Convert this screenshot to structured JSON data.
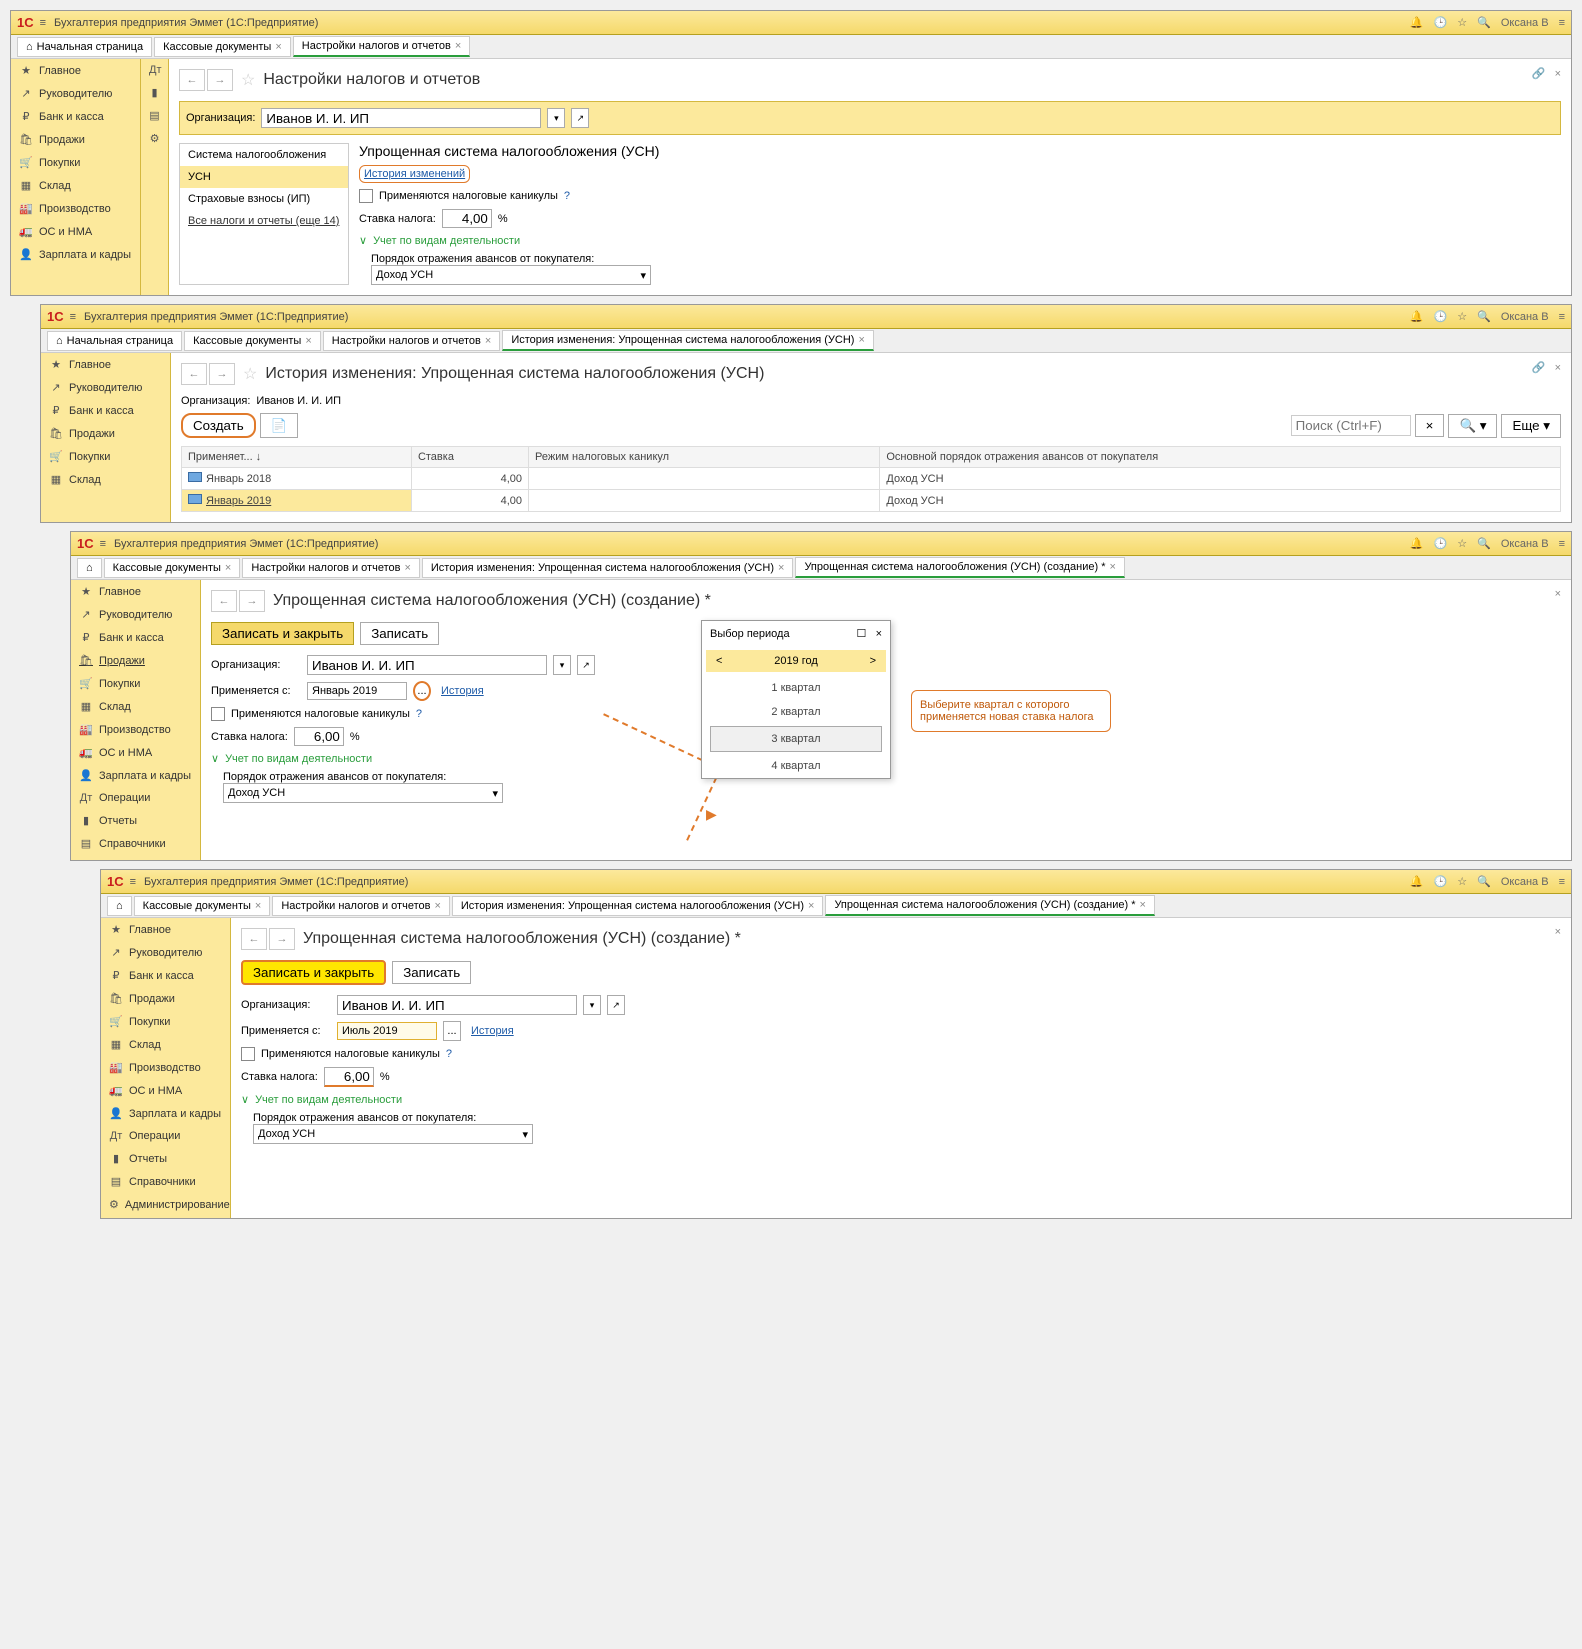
{
  "common": {
    "app_title": "Бухгалтерия предприятия Эммет  (1С:Предприятие)",
    "user": "Оксана В",
    "home": "Начальная страница",
    "tabs": {
      "kass": "Кассовые документы",
      "settings": "Настройки налогов и отчетов",
      "history": "История изменения: Упрощенная система налогообложения (УСН)",
      "create": "Упрощенная система налогообложения (УСН) (создание) *"
    },
    "org_label": "Организация:",
    "org_value": "Иванов И. И. ИП",
    "save_close": "Записать и закрыть",
    "save": "Записать",
    "applies_from": "Применяется с:",
    "history_link": "История",
    "history_changes": "История изменений",
    "holidays": "Применяются налоговые каникулы",
    "rate_label": "Ставка налога:",
    "activity_section": "Учет по видам деятельности",
    "advance_label": "Порядок отражения авансов от покупателя:",
    "income_usn": "Доход УСН",
    "percent": "%"
  },
  "sidebar": {
    "items": [
      {
        "icon": "★",
        "label": "Главное"
      },
      {
        "icon": "↗",
        "label": "Руководителю"
      },
      {
        "icon": "₽",
        "label": "Банк и касса"
      },
      {
        "icon": "🛍",
        "label": "Продажи"
      },
      {
        "icon": "🛒",
        "label": "Покупки"
      },
      {
        "icon": "▦",
        "label": "Склад"
      },
      {
        "icon": "🏭",
        "label": "Производство"
      },
      {
        "icon": "🚛",
        "label": "ОС и НМА"
      },
      {
        "icon": "👤",
        "label": "Зарплата и кадры"
      },
      {
        "icon": "Дт",
        "label": "Операции"
      },
      {
        "icon": "▮",
        "label": "Отчеты"
      },
      {
        "icon": "▤",
        "label": "Справочники"
      },
      {
        "icon": "⚙",
        "label": "Администрирование"
      }
    ]
  },
  "panel1": {
    "title": "Настройки налогов и отчетов",
    "tax_list": [
      "Система налогообложения",
      "УСН",
      "Страховые взносы (ИП)",
      "Все налоги и отчеты (еще 14)"
    ],
    "section": "Упрощенная система налогообложения (УСН)",
    "rate": "4,00"
  },
  "panel2": {
    "title": "История изменения: Упрощенная система налогообложения (УСН)",
    "create_btn": "Создать",
    "search_ph": "Поиск (Ctrl+F)",
    "more": "Еще",
    "cols": [
      "Применяет...",
      "Ставка",
      "Режим налоговых каникул",
      "Основной порядок отражения авансов от покупателя"
    ],
    "rows": [
      {
        "date": "Январь 2018",
        "rate": "4,00",
        "mode": "",
        "order": "Доход УСН"
      },
      {
        "date": "Январь 2019",
        "rate": "4,00",
        "mode": "",
        "order": "Доход УСН"
      }
    ]
  },
  "panel3": {
    "title": "Упрощенная система налогообложения (УСН) (создание) *",
    "date": "Январь 2019",
    "rate": "6,00",
    "popup_title": "Выбор периода",
    "year": "2019 год",
    "quarters": [
      "1 квартал",
      "2 квартал",
      "3 квартал",
      "4 квартал"
    ],
    "callout": "Выберите квартал с которого применяется новая ставка налога"
  },
  "panel4": {
    "title": "Упрощенная система налогообложения (УСН) (создание) *",
    "date": "Июль 2019",
    "rate": "6,00"
  }
}
